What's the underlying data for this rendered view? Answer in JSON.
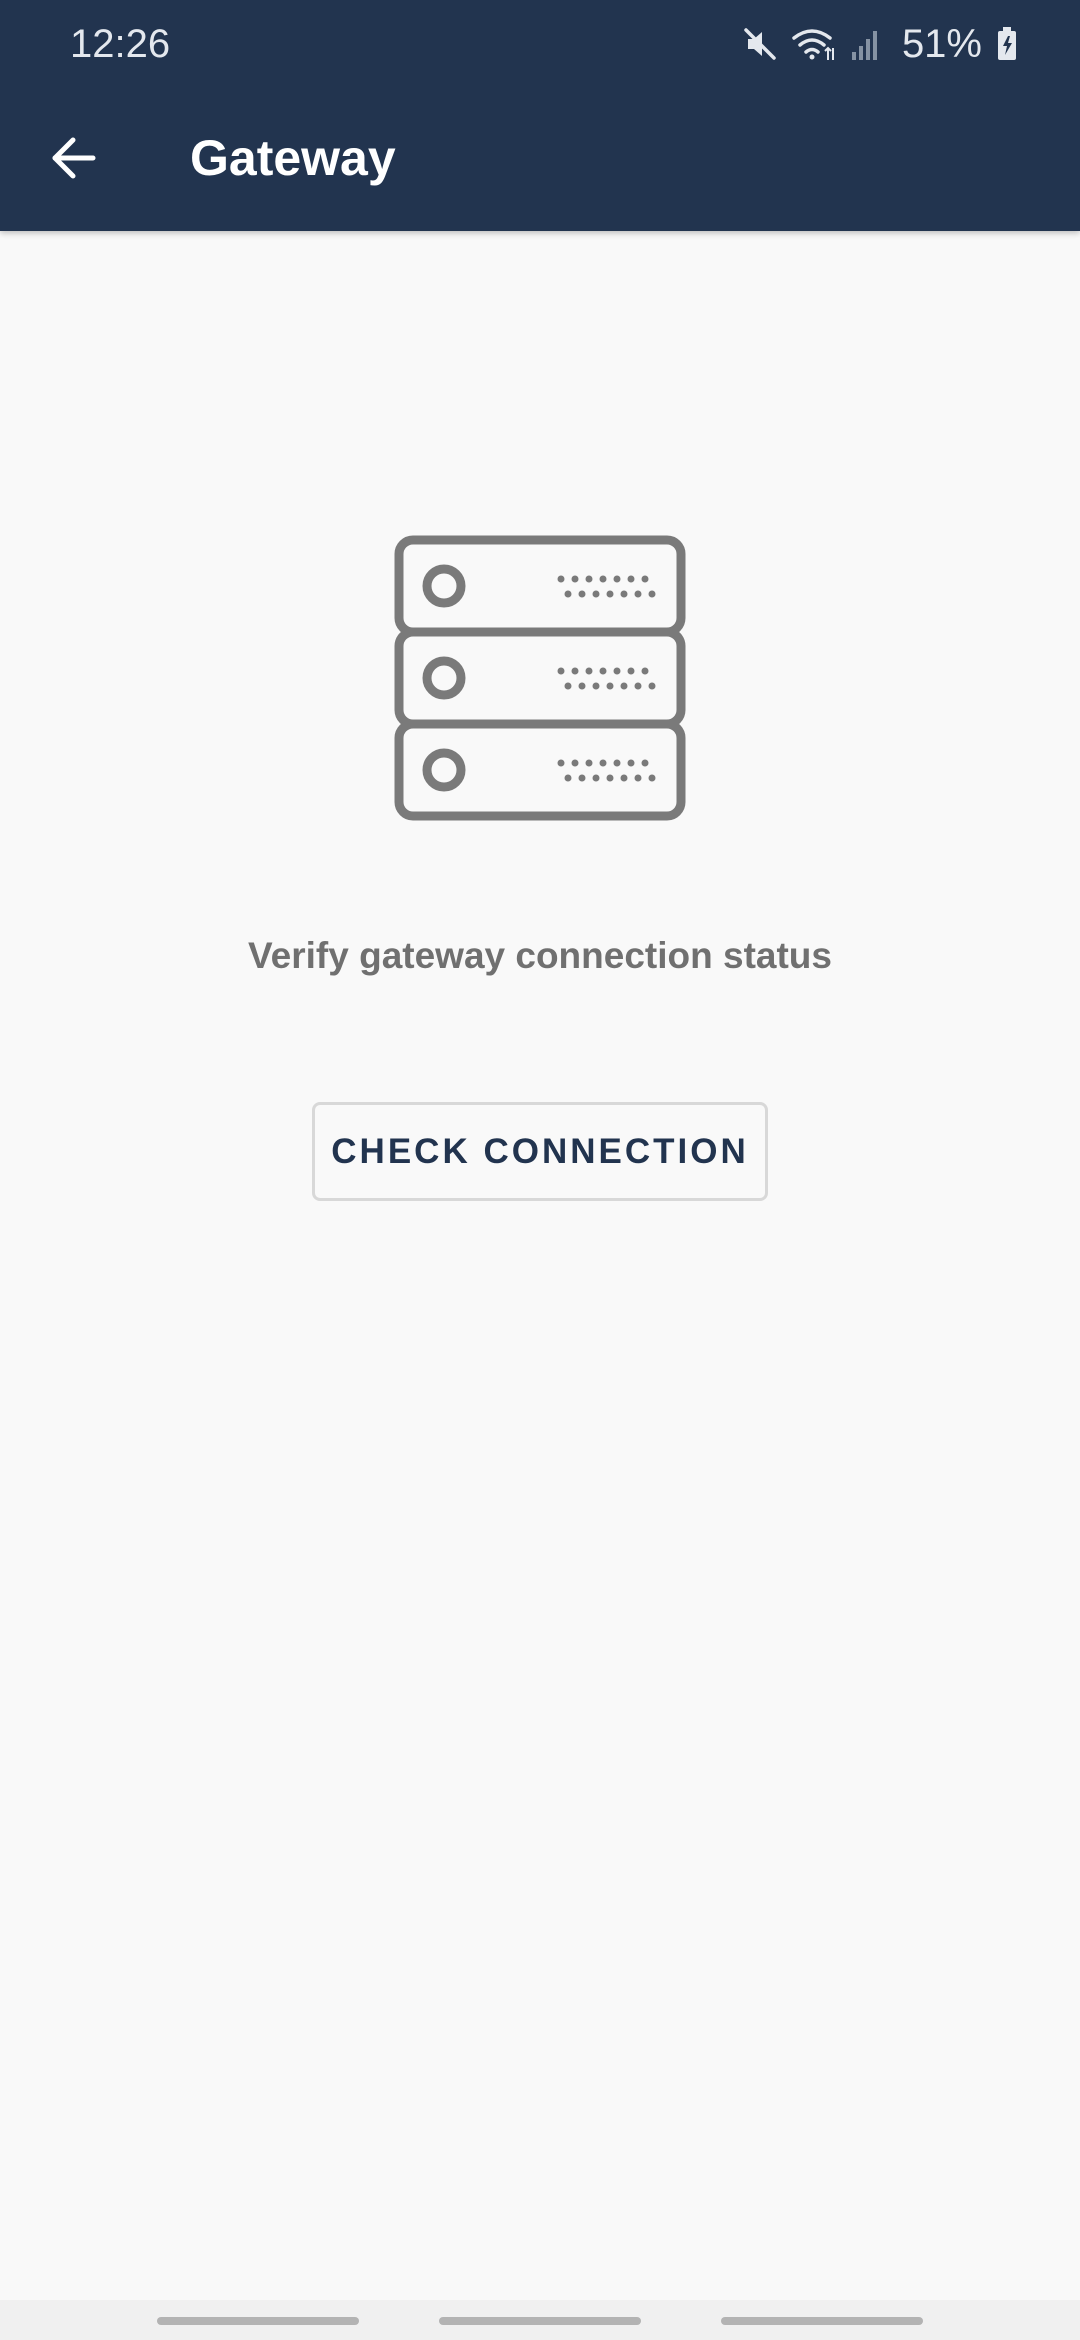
{
  "status_bar": {
    "time": "12:26",
    "battery_percent": "51%",
    "icons": [
      "mute-icon",
      "wifi-icon",
      "signal-icon",
      "battery-charging-icon"
    ]
  },
  "toolbar": {
    "title": "Gateway",
    "back_icon": "arrow-left-icon"
  },
  "main": {
    "illustration_icon": "server-rack-icon",
    "message": "Verify gateway connection status",
    "check_button_label": "CHECK CONNECTION"
  },
  "nav_bar": {
    "handles": 3
  },
  "colors": {
    "header_bg": "#22344f",
    "page_bg": "#f9f9f9",
    "icon_gray": "#7a7a7a",
    "message_text": "#707070",
    "button_text": "#22344f",
    "button_border": "#d8d8d8"
  }
}
